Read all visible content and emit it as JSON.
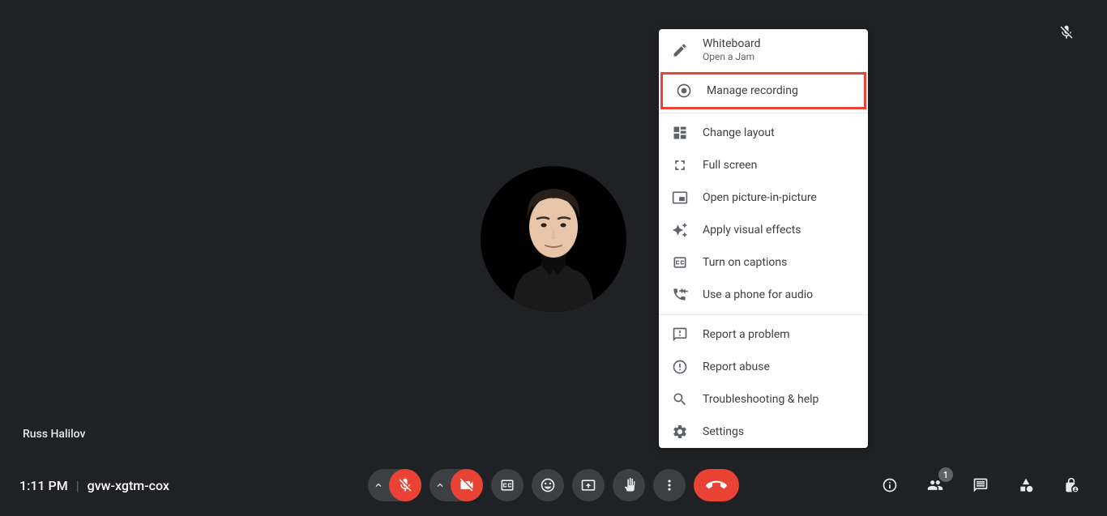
{
  "time": "1:11 PM",
  "meeting_code": "gvw-xgtm-cox",
  "participant_name": "Russ Halilov",
  "participant_count": "1",
  "menu": {
    "whiteboard": {
      "label": "Whiteboard",
      "sublabel": "Open a Jam"
    },
    "recording": {
      "label": "Manage recording"
    },
    "layout": {
      "label": "Change layout"
    },
    "fullscreen": {
      "label": "Full screen"
    },
    "pip": {
      "label": "Open picture-in-picture"
    },
    "visual": {
      "label": "Apply visual effects"
    },
    "captions": {
      "label": "Turn on captions"
    },
    "phone": {
      "label": "Use a phone for audio"
    },
    "report_problem": {
      "label": "Report a problem"
    },
    "report_abuse": {
      "label": "Report abuse"
    },
    "help": {
      "label": "Troubleshooting & help"
    },
    "settings": {
      "label": "Settings"
    }
  }
}
